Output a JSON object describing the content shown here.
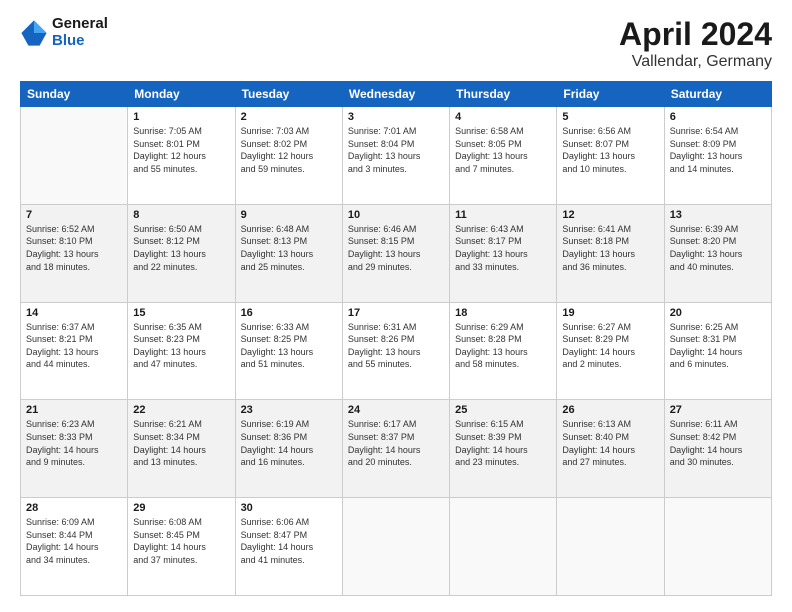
{
  "header": {
    "logo_line1": "General",
    "logo_line2": "Blue",
    "month": "April 2024",
    "location": "Vallendar, Germany"
  },
  "weekdays": [
    "Sunday",
    "Monday",
    "Tuesday",
    "Wednesday",
    "Thursday",
    "Friday",
    "Saturday"
  ],
  "weeks": [
    [
      {
        "day": "",
        "info": ""
      },
      {
        "day": "1",
        "info": "Sunrise: 7:05 AM\nSunset: 8:01 PM\nDaylight: 12 hours\nand 55 minutes."
      },
      {
        "day": "2",
        "info": "Sunrise: 7:03 AM\nSunset: 8:02 PM\nDaylight: 12 hours\nand 59 minutes."
      },
      {
        "day": "3",
        "info": "Sunrise: 7:01 AM\nSunset: 8:04 PM\nDaylight: 13 hours\nand 3 minutes."
      },
      {
        "day": "4",
        "info": "Sunrise: 6:58 AM\nSunset: 8:05 PM\nDaylight: 13 hours\nand 7 minutes."
      },
      {
        "day": "5",
        "info": "Sunrise: 6:56 AM\nSunset: 8:07 PM\nDaylight: 13 hours\nand 10 minutes."
      },
      {
        "day": "6",
        "info": "Sunrise: 6:54 AM\nSunset: 8:09 PM\nDaylight: 13 hours\nand 14 minutes."
      }
    ],
    [
      {
        "day": "7",
        "info": "Sunrise: 6:52 AM\nSunset: 8:10 PM\nDaylight: 13 hours\nand 18 minutes."
      },
      {
        "day": "8",
        "info": "Sunrise: 6:50 AM\nSunset: 8:12 PM\nDaylight: 13 hours\nand 22 minutes."
      },
      {
        "day": "9",
        "info": "Sunrise: 6:48 AM\nSunset: 8:13 PM\nDaylight: 13 hours\nand 25 minutes."
      },
      {
        "day": "10",
        "info": "Sunrise: 6:46 AM\nSunset: 8:15 PM\nDaylight: 13 hours\nand 29 minutes."
      },
      {
        "day": "11",
        "info": "Sunrise: 6:43 AM\nSunset: 8:17 PM\nDaylight: 13 hours\nand 33 minutes."
      },
      {
        "day": "12",
        "info": "Sunrise: 6:41 AM\nSunset: 8:18 PM\nDaylight: 13 hours\nand 36 minutes."
      },
      {
        "day": "13",
        "info": "Sunrise: 6:39 AM\nSunset: 8:20 PM\nDaylight: 13 hours\nand 40 minutes."
      }
    ],
    [
      {
        "day": "14",
        "info": "Sunrise: 6:37 AM\nSunset: 8:21 PM\nDaylight: 13 hours\nand 44 minutes."
      },
      {
        "day": "15",
        "info": "Sunrise: 6:35 AM\nSunset: 8:23 PM\nDaylight: 13 hours\nand 47 minutes."
      },
      {
        "day": "16",
        "info": "Sunrise: 6:33 AM\nSunset: 8:25 PM\nDaylight: 13 hours\nand 51 minutes."
      },
      {
        "day": "17",
        "info": "Sunrise: 6:31 AM\nSunset: 8:26 PM\nDaylight: 13 hours\nand 55 minutes."
      },
      {
        "day": "18",
        "info": "Sunrise: 6:29 AM\nSunset: 8:28 PM\nDaylight: 13 hours\nand 58 minutes."
      },
      {
        "day": "19",
        "info": "Sunrise: 6:27 AM\nSunset: 8:29 PM\nDaylight: 14 hours\nand 2 minutes."
      },
      {
        "day": "20",
        "info": "Sunrise: 6:25 AM\nSunset: 8:31 PM\nDaylight: 14 hours\nand 6 minutes."
      }
    ],
    [
      {
        "day": "21",
        "info": "Sunrise: 6:23 AM\nSunset: 8:33 PM\nDaylight: 14 hours\nand 9 minutes."
      },
      {
        "day": "22",
        "info": "Sunrise: 6:21 AM\nSunset: 8:34 PM\nDaylight: 14 hours\nand 13 minutes."
      },
      {
        "day": "23",
        "info": "Sunrise: 6:19 AM\nSunset: 8:36 PM\nDaylight: 14 hours\nand 16 minutes."
      },
      {
        "day": "24",
        "info": "Sunrise: 6:17 AM\nSunset: 8:37 PM\nDaylight: 14 hours\nand 20 minutes."
      },
      {
        "day": "25",
        "info": "Sunrise: 6:15 AM\nSunset: 8:39 PM\nDaylight: 14 hours\nand 23 minutes."
      },
      {
        "day": "26",
        "info": "Sunrise: 6:13 AM\nSunset: 8:40 PM\nDaylight: 14 hours\nand 27 minutes."
      },
      {
        "day": "27",
        "info": "Sunrise: 6:11 AM\nSunset: 8:42 PM\nDaylight: 14 hours\nand 30 minutes."
      }
    ],
    [
      {
        "day": "28",
        "info": "Sunrise: 6:09 AM\nSunset: 8:44 PM\nDaylight: 14 hours\nand 34 minutes."
      },
      {
        "day": "29",
        "info": "Sunrise: 6:08 AM\nSunset: 8:45 PM\nDaylight: 14 hours\nand 37 minutes."
      },
      {
        "day": "30",
        "info": "Sunrise: 6:06 AM\nSunset: 8:47 PM\nDaylight: 14 hours\nand 41 minutes."
      },
      {
        "day": "",
        "info": ""
      },
      {
        "day": "",
        "info": ""
      },
      {
        "day": "",
        "info": ""
      },
      {
        "day": "",
        "info": ""
      }
    ]
  ]
}
